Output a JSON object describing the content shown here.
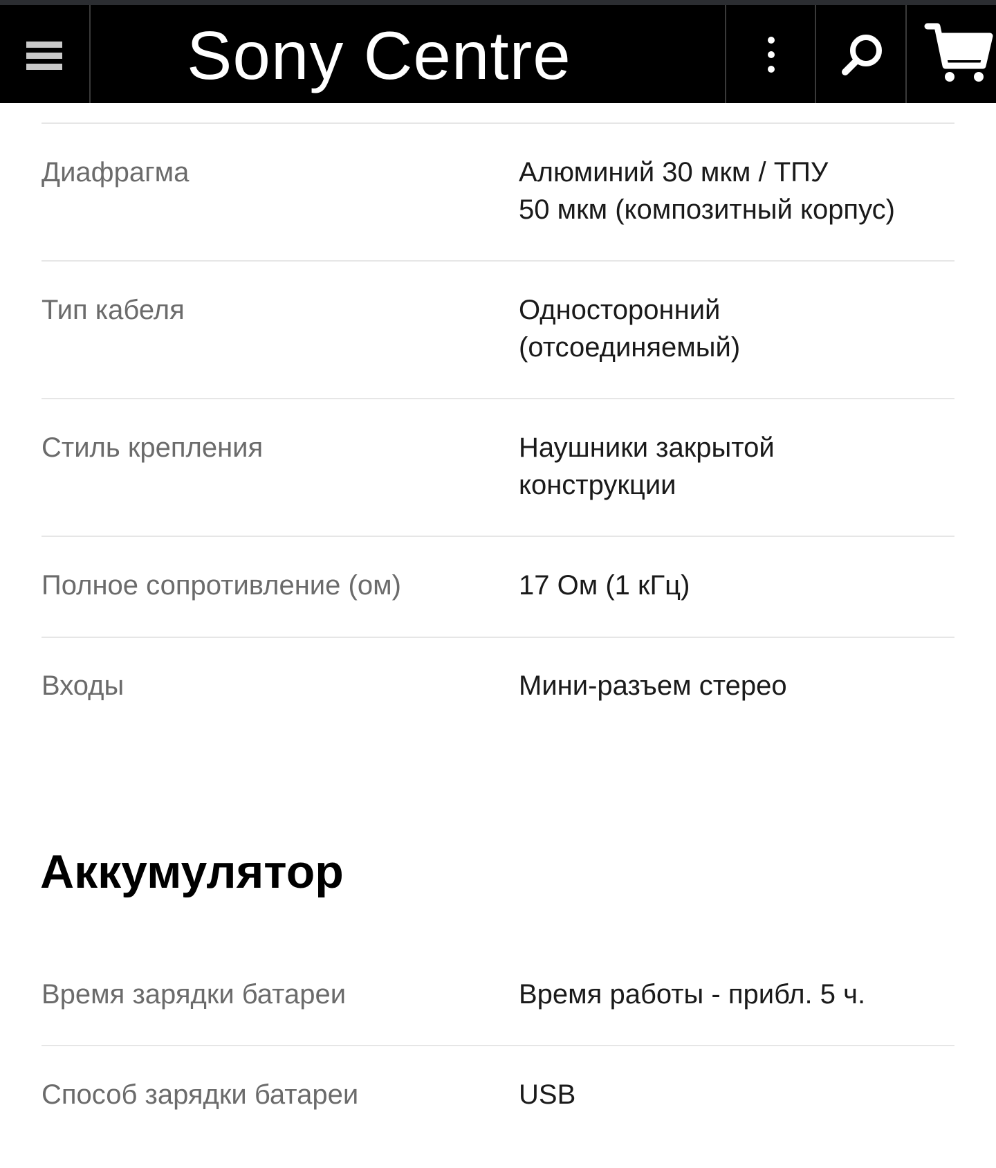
{
  "header": {
    "logo_text": "Sony Centre",
    "menu_icon": "hamburger-menu-icon",
    "more_icon": "more-vertical-icon",
    "search_icon": "search-icon",
    "cart_icon": "shopping-cart-icon",
    "background": "#000000"
  },
  "specs": [
    {
      "label": "Диафрагма",
      "value": "Алюминий 30 мкм  / ТПУ\n50 мкм (композитный корпус)"
    },
    {
      "label": "Тип кабеля",
      "value": "Односторонний\n(отсоединяемый)"
    },
    {
      "label": "Стиль крепления",
      "value": "Наушники закрытой\nконструкции"
    },
    {
      "label": "Полное сопротивление (ом)",
      "value": "17 Ом (1 кГц)"
    },
    {
      "label": "Входы",
      "value": "Мини-разъем стерео"
    }
  ],
  "battery_section": {
    "title": "Аккумулятор",
    "specs": [
      {
        "label": "Время зарядки батареи",
        "value": "Время работы - прибл. 5 ч."
      },
      {
        "label": "Способ зарядки батареи",
        "value": "USB"
      }
    ]
  }
}
